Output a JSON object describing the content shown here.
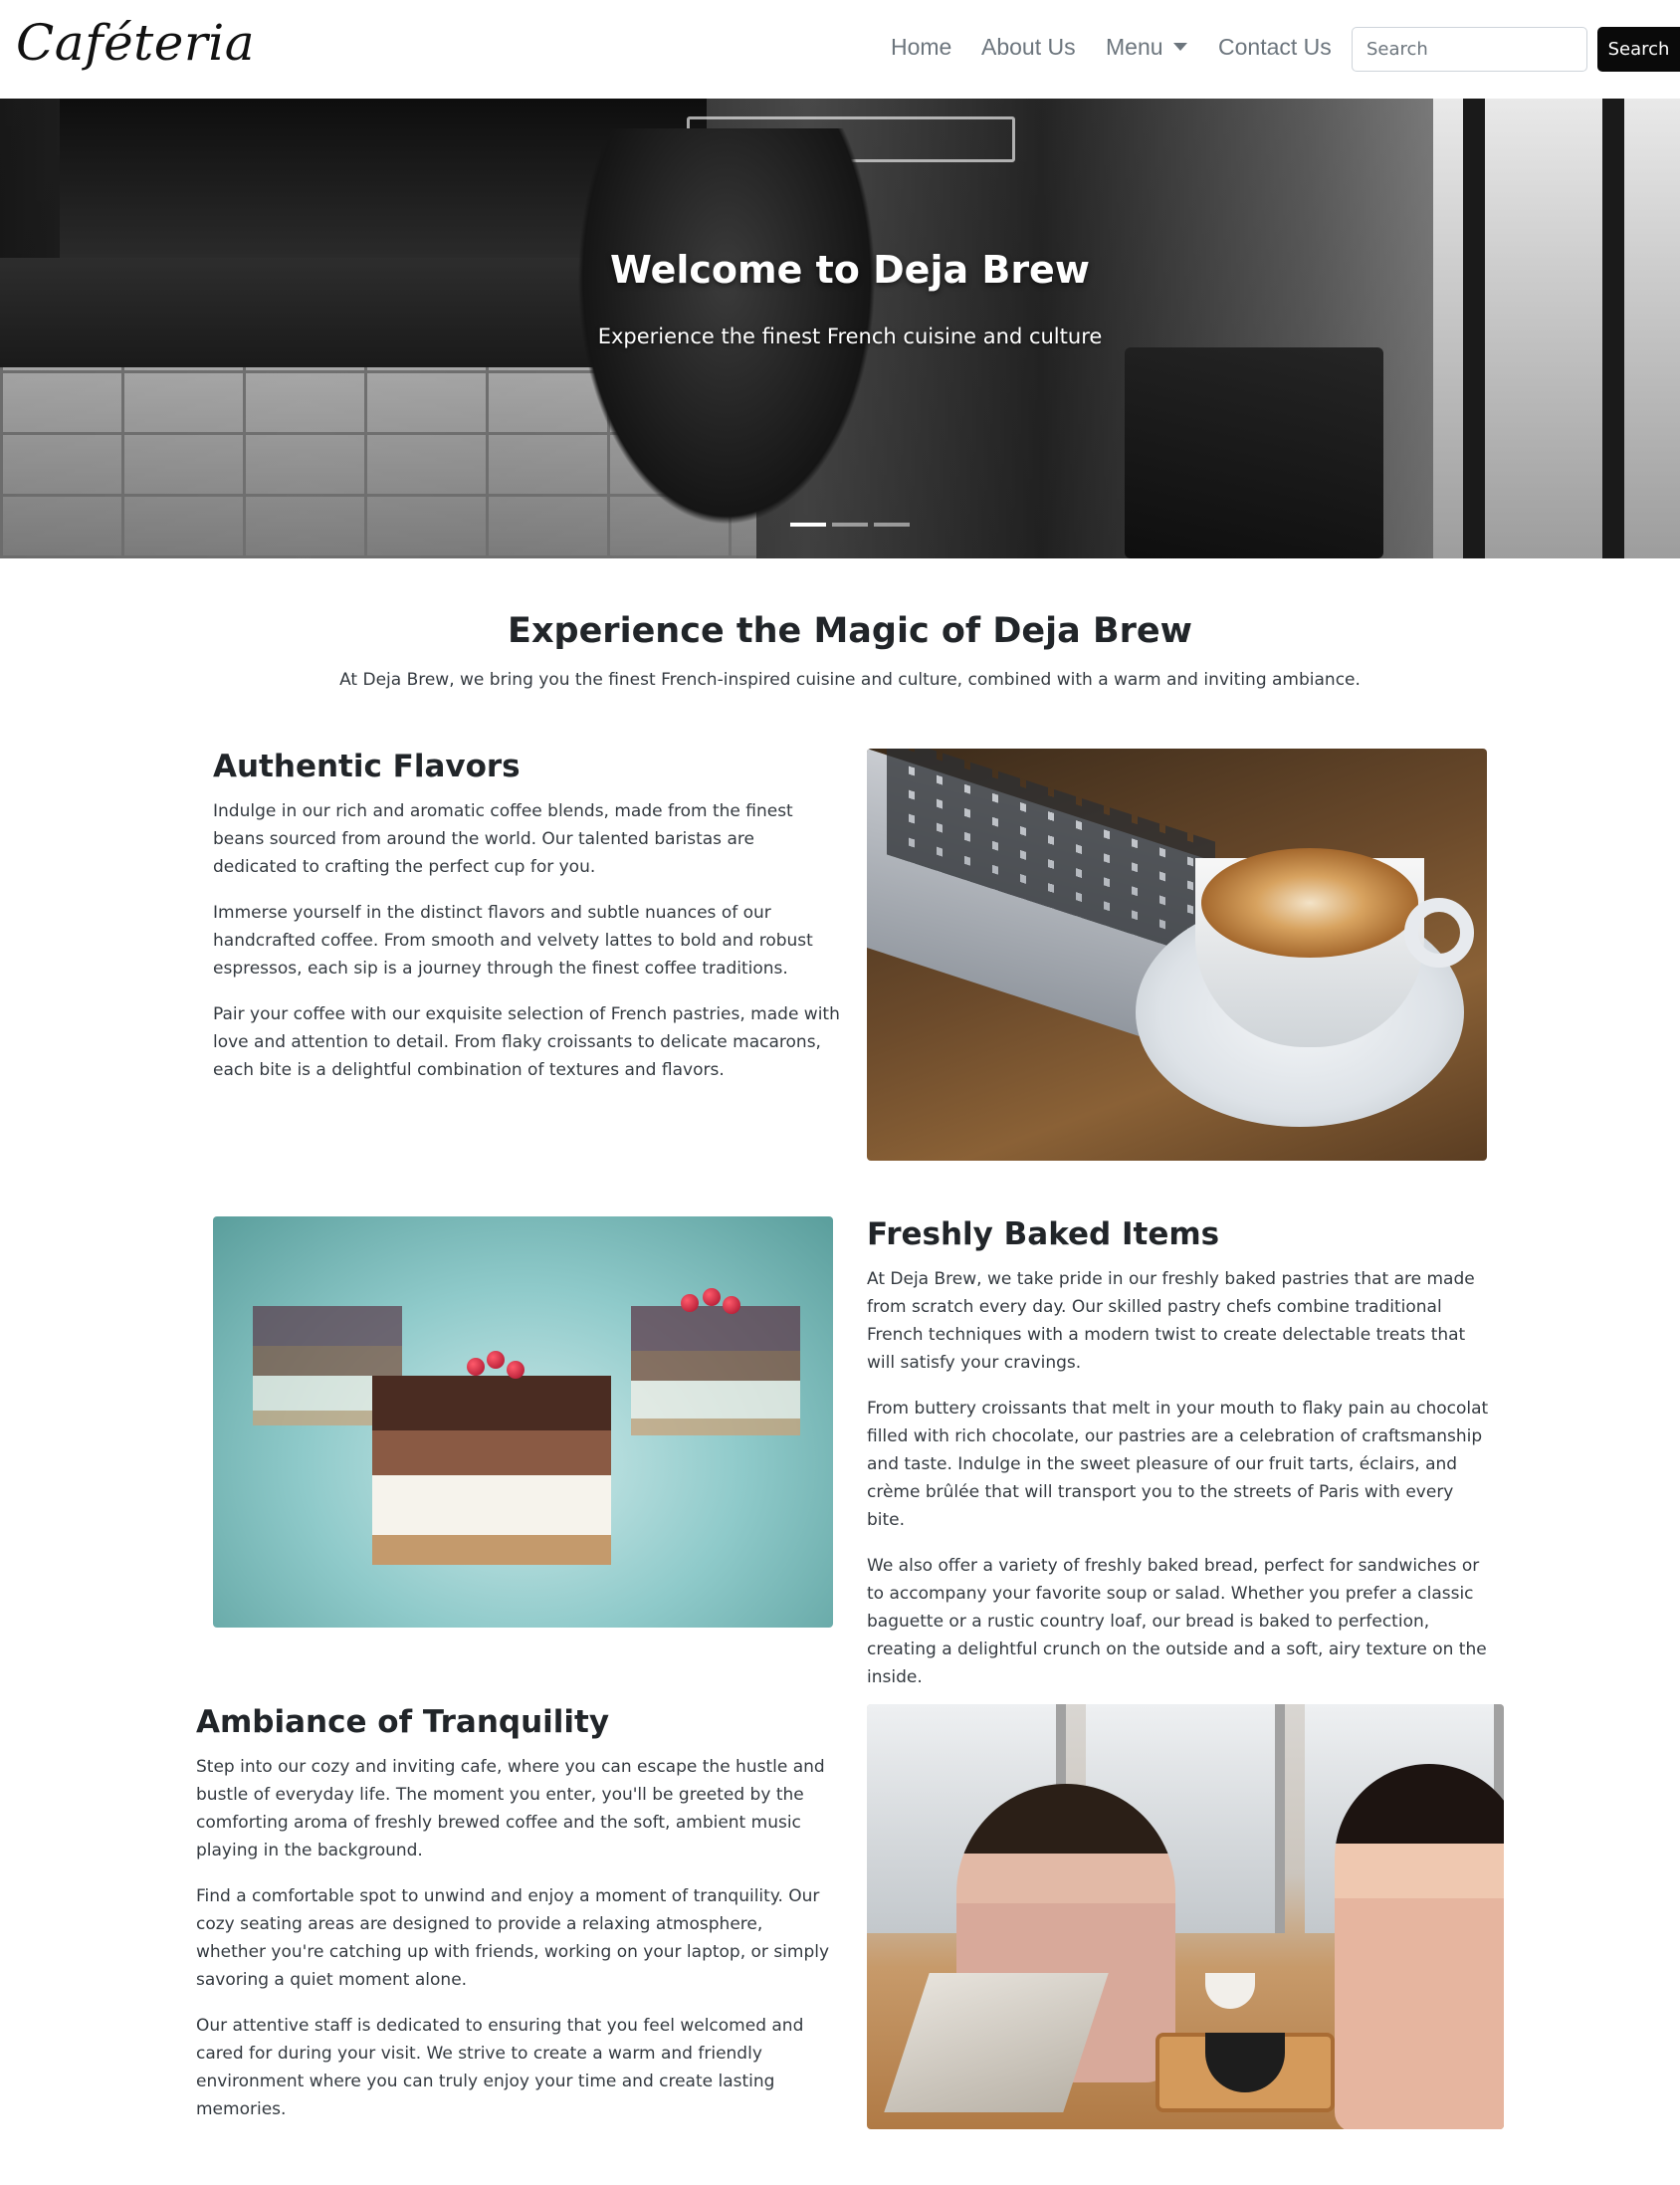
{
  "navbar": {
    "brand": "Caféteria",
    "links": [
      {
        "label": "Home"
      },
      {
        "label": "About Us"
      },
      {
        "label": "Menu",
        "dropdown": true
      },
      {
        "label": "Contact Us"
      }
    ],
    "search": {
      "placeholder": "Search",
      "button_label": "Search"
    }
  },
  "hero": {
    "title": "Welcome to Deja Brew",
    "subtitle": "Experience the finest French cuisine and culture",
    "carousel": {
      "slides": 3,
      "active_index": 0
    }
  },
  "intro": {
    "title": "Experience the Magic of Deja Brew",
    "lead": "At Deja Brew, we bring you the finest French-inspired cuisine and culture, combined with a warm and inviting ambiance."
  },
  "features": [
    {
      "heading": "Authentic Flavors",
      "paragraphs": [
        "Indulge in our rich and aromatic coffee blends, made from the finest beans sourced from around the world. Our talented baristas are dedicated to crafting the perfect cup for you.",
        "Immerse yourself in the distinct flavors and subtle nuances of our handcrafted coffee. From smooth and velvety lattes to bold and robust espressos, each sip is a journey through the finest coffee traditions.",
        "Pair your coffee with our exquisite selection of French pastries, made with love and attention to detail. From flaky croissants to delicate macarons, each bite is a delightful combination of textures and flavors."
      ],
      "image": "coffee-cup-and-laptop-photo"
    },
    {
      "heading": "Freshly Baked Items",
      "paragraphs": [
        "At Deja Brew, we take pride in our freshly baked pastries that are made from scratch every day. Our skilled pastry chefs combine traditional French techniques with a modern twist to create delectable treats that will satisfy your cravings.",
        "From buttery croissants that melt in your mouth to flaky pain au chocolat filled with rich chocolate, our pastries are a celebration of craftsmanship and taste. Indulge in the sweet pleasure of our fruit tarts, éclairs, and crème brûlée that will transport you to the streets of Paris with every bite.",
        "We also offer a variety of freshly baked bread, perfect for sandwiches or to accompany your favorite soup or salad. Whether you prefer a classic baguette or a rustic country loaf, our bread is baked to perfection, creating a delightful crunch on the outside and a soft, airy texture on the inside."
      ],
      "image": "chocolate-cakes-photo"
    },
    {
      "heading": "Ambiance of Tranquility",
      "paragraphs": [
        "Step into our cozy and inviting cafe, where you can escape the hustle and bustle of everyday life. The moment you enter, you'll be greeted by the comforting aroma of freshly brewed coffee and the soft, ambient music playing in the background.",
        "Find a comfortable spot to unwind and enjoy a moment of tranquility. Our cozy seating areas are designed to provide a relaxing atmosphere, whether you're catching up with friends, working on your laptop, or simply savoring a quiet moment alone.",
        "Our attentive staff is dedicated to ensuring that you feel welcomed and cared for during your visit. We strive to create a warm and friendly environment where you can truly enjoy your time and create lasting memories."
      ],
      "image": "friends-at-cafe-table-photo"
    }
  ]
}
